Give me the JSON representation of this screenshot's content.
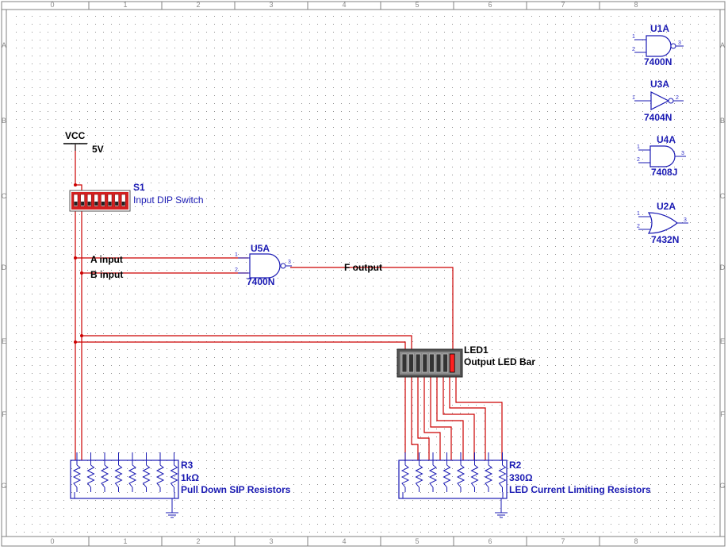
{
  "border": {
    "columns": [
      "0",
      "1",
      "2",
      "3",
      "4",
      "5",
      "6",
      "7",
      "8"
    ],
    "rows": [
      "A",
      "B",
      "C",
      "D",
      "E",
      "F",
      "G"
    ]
  },
  "power": {
    "name": "VCC",
    "value": "5V"
  },
  "switch": {
    "ref": "S1",
    "desc": "Input DIP Switch"
  },
  "gate_main": {
    "ref": "U5A",
    "type": "7400N",
    "pin_a": "1",
    "pin_b": "2",
    "pin_out": "3"
  },
  "nets": {
    "a": "A input",
    "b": "B input",
    "f": "F output"
  },
  "led": {
    "ref": "LED1",
    "desc": "Output LED Bar"
  },
  "r_pulldown": {
    "ref": "R3",
    "value": "1kΩ",
    "desc": "Pull Down SIP Resistors"
  },
  "r_limit": {
    "ref": "R2",
    "value": "330Ω",
    "desc": "LED Current Limiting Resistors"
  },
  "palette": [
    {
      "ref": "U1A",
      "type": "7400N",
      "symbol": "nand",
      "pins": [
        "1",
        "2",
        "3"
      ]
    },
    {
      "ref": "U3A",
      "type": "7404N",
      "symbol": "not",
      "pins": [
        "1",
        "2"
      ]
    },
    {
      "ref": "U4A",
      "type": "7408J",
      "symbol": "and",
      "pins": [
        "1",
        "2",
        "3"
      ]
    },
    {
      "ref": "U2A",
      "type": "7432N",
      "symbol": "or",
      "pins": [
        "1",
        "2",
        "3"
      ]
    }
  ],
  "colors": {
    "wire": "#cc0000",
    "component": "#1a1ab3",
    "switch_body": "#d42020",
    "led_on": "#ff2020"
  }
}
